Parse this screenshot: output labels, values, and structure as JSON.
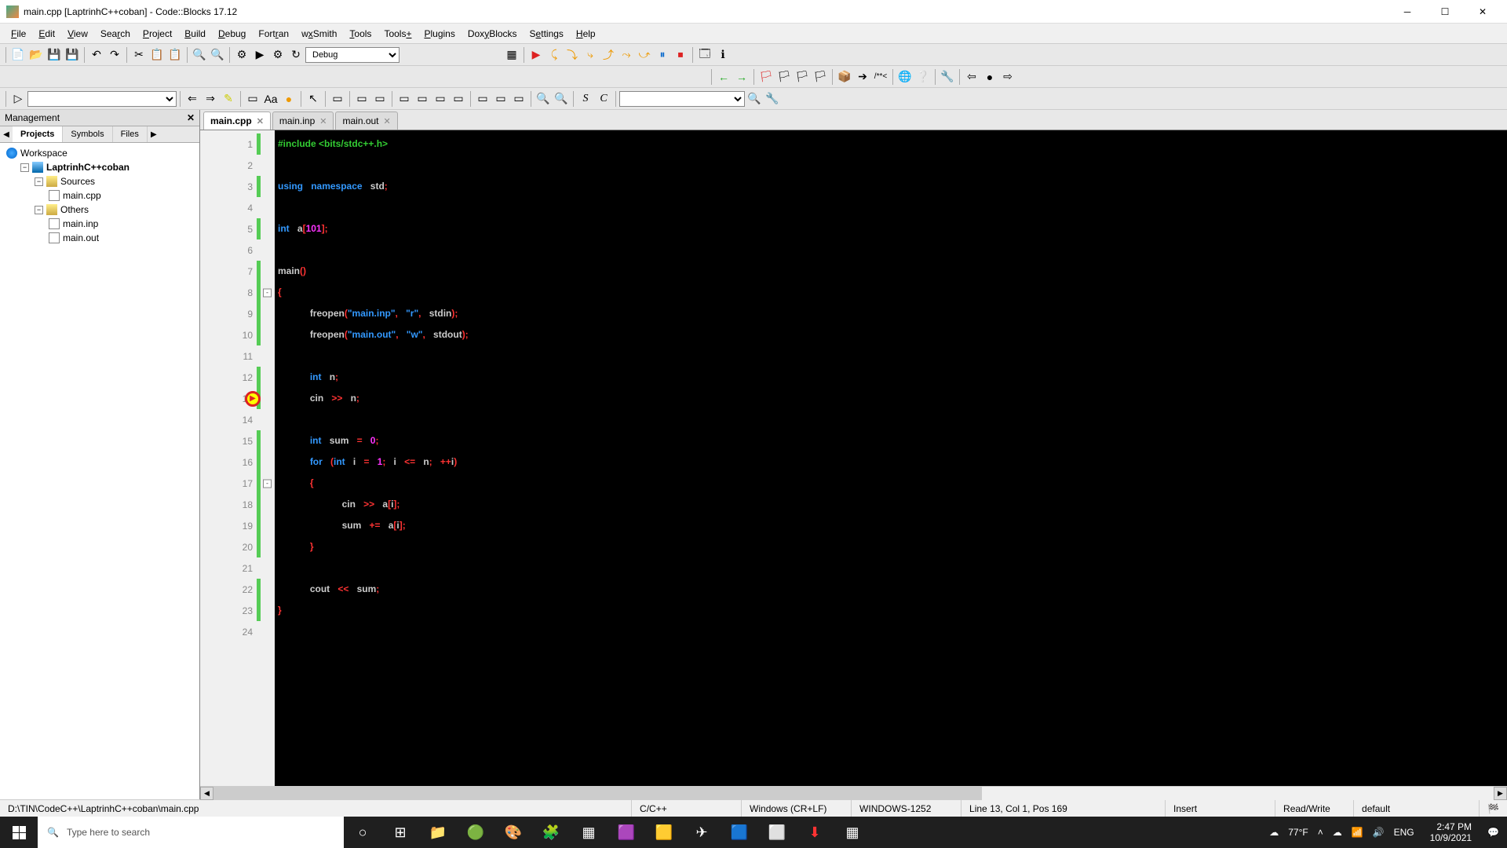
{
  "titlebar": {
    "text": "main.cpp [LaptrinhC++coban] - Code::Blocks 17.12"
  },
  "menus": [
    "File",
    "Edit",
    "View",
    "Search",
    "Project",
    "Build",
    "Debug",
    "Fortran",
    "wxSmith",
    "Tools",
    "Tools+",
    "Plugins",
    "DoxyBlocks",
    "Settings",
    "Help"
  ],
  "menu_underline_index": [
    0,
    0,
    0,
    3,
    0,
    0,
    0,
    4,
    1,
    0,
    5,
    0,
    3,
    1,
    0
  ],
  "toolbar_combo1": "Debug",
  "management": {
    "title": "Management",
    "tabs": [
      "Projects",
      "Symbols",
      "Files"
    ],
    "active_tab": 0,
    "workspace": "Workspace",
    "project": "LaptrinhC++coban",
    "sources_label": "Sources",
    "sources": [
      "main.cpp"
    ],
    "others_label": "Others",
    "others": [
      "main.inp",
      "main.out"
    ]
  },
  "editor_tabs": [
    {
      "label": "main.cpp",
      "active": true
    },
    {
      "label": "main.inp",
      "active": false
    },
    {
      "label": "main.out",
      "active": false
    }
  ],
  "total_lines": 24,
  "changed_lines": [
    1,
    3,
    5,
    7,
    8,
    9,
    10,
    12,
    13,
    15,
    16,
    17,
    18,
    19,
    20,
    22,
    23
  ],
  "fold_lines": {
    "8": "-",
    "17": "-"
  },
  "debug_line": 13,
  "statusbar": {
    "path": "D:\\TIN\\CodeC++\\LaptrinhC++coban\\main.cpp",
    "lang": "C/C++",
    "eol": "Windows (CR+LF)",
    "encoding": "WINDOWS-1252",
    "pos": "Line 13, Col 1, Pos 169",
    "insert": "Insert",
    "rw": "Read/Write",
    "profile": "default"
  },
  "taskbar": {
    "search_placeholder": "Type here to search",
    "weather": "77°F",
    "lang": "ENG",
    "time": "2:47 PM",
    "date": "10/9/2021"
  }
}
